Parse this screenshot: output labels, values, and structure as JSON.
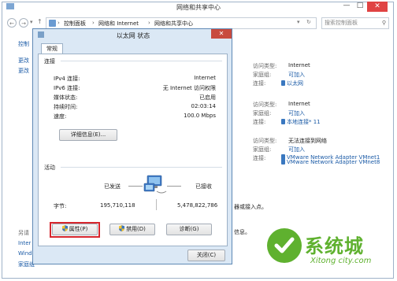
{
  "window": {
    "title": "网络和共享中心"
  },
  "breadcrumb": {
    "items": [
      "控制面板",
      "网络和 Internet",
      "网络和共享中心"
    ],
    "sep": "›"
  },
  "search": {
    "placeholder": "搜索控制面板"
  },
  "background": {
    "left_links": [
      "控制",
      "更改",
      "更改"
    ],
    "bottom_left": [
      "另请",
      "Inter",
      "Windo",
      "家庭组"
    ],
    "connections": [
      {
        "access_label": "访问类型:",
        "access_value": "Internet",
        "homegroup_label": "家庭组:",
        "homegroup_value": "可加入",
        "conn_label": "连接:",
        "conn_value": "以太网"
      },
      {
        "access_label": "访问类型:",
        "access_value": "Internet",
        "homegroup_label": "家庭组:",
        "homegroup_value": "可加入",
        "conn_label": "连接:",
        "conn_value": "本地连接* 11"
      },
      {
        "access_label": "访问类型:",
        "access_value": "无法连接到网络",
        "homegroup_label": "家庭组:",
        "homegroup_value": "可加入",
        "conn_label": "连接:",
        "conn_value": "VMware Network Adapter VMnet1",
        "conn_value2": "VMware Network Adapter VMnet8"
      }
    ],
    "tail1": "器或接入点。",
    "tail2": "信息。"
  },
  "dialog": {
    "title": "以太网 状态",
    "tab": "常规",
    "connection_header": "连接",
    "rows": [
      {
        "label": "IPv4 连接:",
        "value": "Internet"
      },
      {
        "label": "IPv6 连接:",
        "value": "无 Internet 访问权限"
      },
      {
        "label": "媒体状态:",
        "value": "已启用"
      },
      {
        "label": "持续时间:",
        "value": "02:03:14"
      },
      {
        "label": "速度:",
        "value": "100.0 Mbps"
      }
    ],
    "details_button": "详细信息(E)...",
    "activity_header": "活动",
    "sent_label": "已发送",
    "received_label": "已接收",
    "bytes_label": "字节:",
    "bytes_sent": "195,710,118",
    "bytes_received": "5,478,822,786",
    "properties_button": "属性(P)",
    "disable_button": "禁用(D)",
    "diagnose_button": "诊断(G)",
    "close_button": "关闭(C)"
  },
  "watermark": {
    "brand": "系统城",
    "url": "Xitong city.com"
  },
  "colors": {
    "link": "#1a5aa6",
    "dialog_bg": "#dbe8f5",
    "highlight": "#d7262d",
    "watermark_green": "#5fb12f"
  }
}
